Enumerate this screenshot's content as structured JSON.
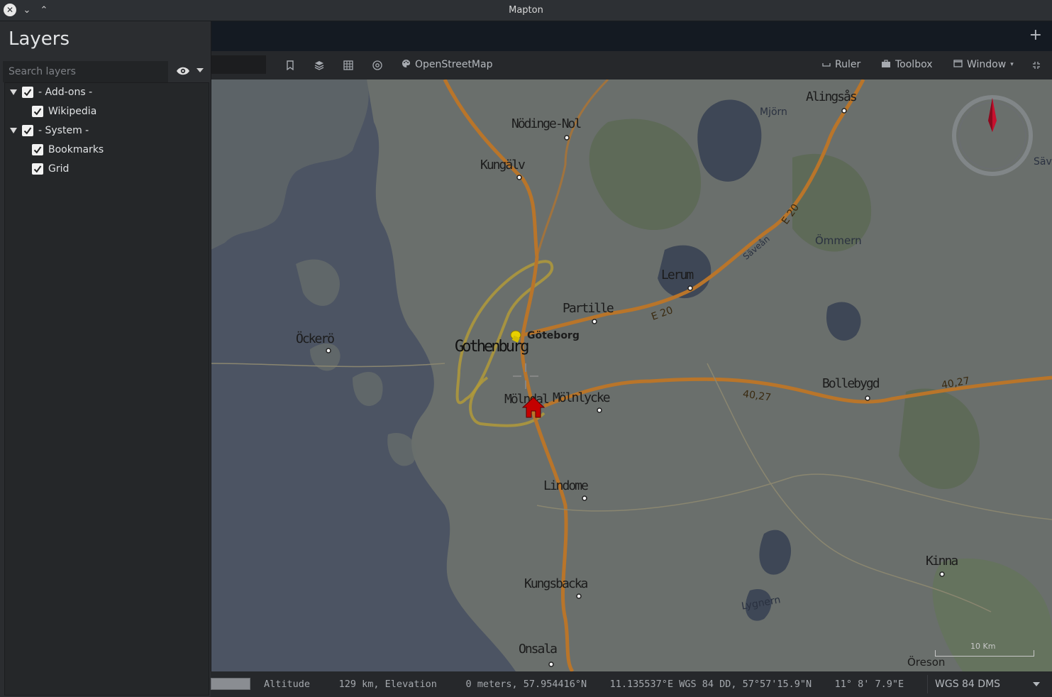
{
  "window": {
    "title": "Mapton"
  },
  "layers_panel": {
    "title": "Layers",
    "search_placeholder": "Search layers",
    "groups": [
      {
        "label": "- Add-ons -",
        "checked": true,
        "items": [
          {
            "label": "Wikipedia",
            "checked": true
          }
        ]
      },
      {
        "label": "- System -",
        "checked": true,
        "items": [
          {
            "label": "Bookmarks",
            "checked": true
          },
          {
            "label": "Grid",
            "checked": true
          }
        ]
      }
    ]
  },
  "toolbar": {
    "icons": [
      "bookmark-icon",
      "layers-icon",
      "grid-icon",
      "target-icon",
      "palette-icon"
    ],
    "basemap_label": "OpenStreetMap",
    "ruler_label": "Ruler",
    "toolbox_label": "Toolbox",
    "window_label": "Window"
  },
  "map": {
    "place_labels": {
      "alingsas": "Alingsås",
      "mjorn": "Mjörn",
      "nodinge": "Nödinge-Nol",
      "kungalv": "Kungälv",
      "save": "Säve",
      "e20_1": "E 20",
      "ommern": "Ömmern",
      "savean": "Säveån",
      "lerum": "Lerum",
      "partille": "Partille",
      "e20_2": "E 20",
      "ockero": "Öckerö",
      "goteborg": "Göteborg",
      "gothenburg": "Gothenburg",
      "molndal": "Mölndal",
      "molnlycke": "Mölnlycke",
      "r4027_1": "40,27",
      "bollebygd": "Bollebygd",
      "r4027_2": "40,27",
      "lindome": "Lindome",
      "kinna": "Kinna",
      "kungsbacka": "Kungsbacka",
      "lygnern": "Lygnern",
      "onsala": "Onsala",
      "oreson": "Öreson"
    },
    "scale_label": "10 Km",
    "colors": {
      "water": "#4c5463",
      "land": "#6a6f6c",
      "road": "#b9752a",
      "ring": "#b09a3a",
      "pin": "#e8d000",
      "home": "#d40000",
      "compass_needle": "#c8102e"
    }
  },
  "statusbar": {
    "text": "Altitude     129 km, Elevation     0 meters, 57.954416°N    11.135537°E WGS 84 DD, 57°57'15.9\"N    11° 8' 7.9\"E",
    "coord_system": "WGS 84 DMS"
  }
}
